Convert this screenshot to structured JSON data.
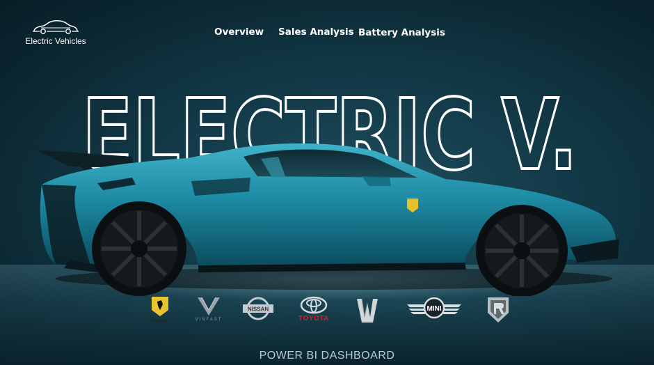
{
  "logo": {
    "text": "Electric Vehicles",
    "icon": "car-outline-icon"
  },
  "nav": {
    "items": [
      {
        "label": "Overview"
      },
      {
        "label": "Sales Analysis"
      },
      {
        "label": "Battery Analysis"
      }
    ]
  },
  "hero": {
    "title": "ELECTRIC V."
  },
  "brands": {
    "ferrari": "Ferrari",
    "vinfast": "VINFAST",
    "nissan": "NISSAN",
    "toyota": "TOYOTA",
    "mini": "MINI"
  },
  "footer": {
    "text": "POWER BI DASHBOARD"
  },
  "colors": {
    "background": "#0f3441",
    "car_body": "#1e8fa8",
    "accent_red": "#d6202a"
  }
}
